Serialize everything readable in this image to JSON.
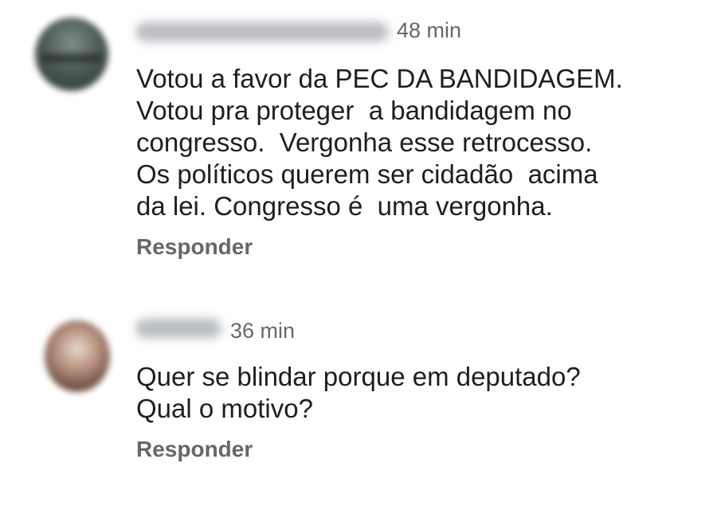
{
  "comments": [
    {
      "time": "48 min",
      "lines": [
        "Votou a favor da PEC DA BANDIDAGEM.",
        "Votou pra proteger  a bandidagem no",
        "congresso.  Vergonha esse retrocesso.",
        "Os políticos querem ser cidadão  acima",
        "da lei. Congresso é  uma vergonha."
      ],
      "reply_label": "Responder"
    },
    {
      "time": "36 min",
      "lines": [
        "Quer se blindar porque em deputado?",
        "Qual o motivo?"
      ],
      "reply_label": "Responder"
    }
  ],
  "colors": {
    "text": "#1c1e21",
    "meta": "#65676b",
    "background": "#ffffff"
  }
}
